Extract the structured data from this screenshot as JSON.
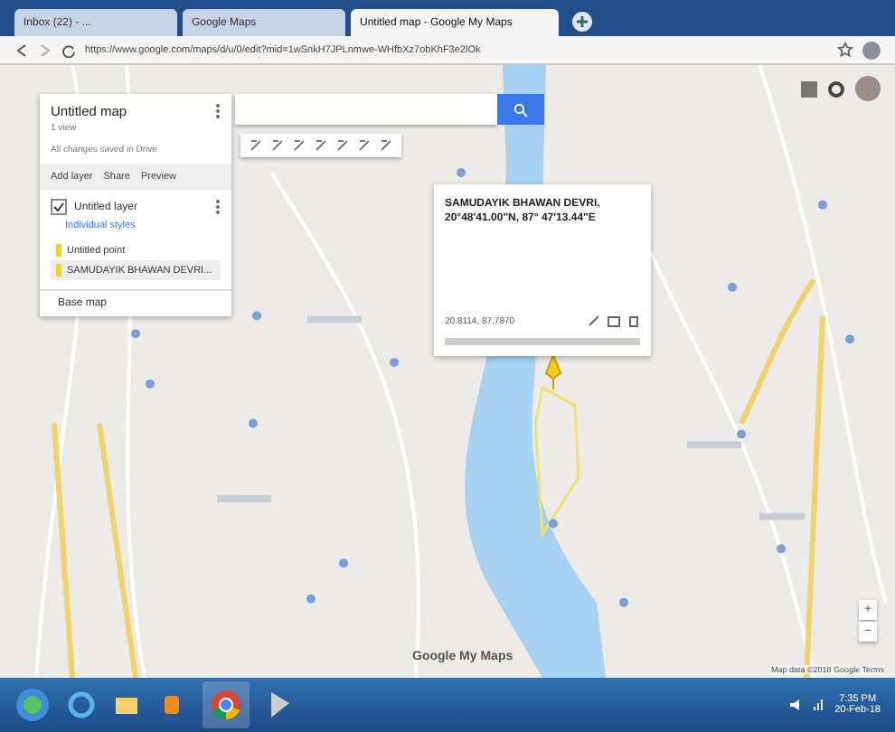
{
  "browser": {
    "tabs": [
      {
        "title": "Inbox (22) - ...",
        "selected": false
      },
      {
        "title": "Google Maps",
        "selected": false
      },
      {
        "title": "Untitled map - Google My Maps",
        "selected": true
      }
    ],
    "url": "https://www.google.com/maps/d/u/0/edit?mid=1wSnkH7JPLnmwe-WHfbXz7obKhF3e2lOk"
  },
  "panel": {
    "title": "Untitled map",
    "subtitle": "1 view",
    "status": "All changes saved in Drive",
    "actions": [
      "Add layer",
      "Share",
      "Preview"
    ],
    "layer": {
      "name": "Untitled layer",
      "checked": true,
      "style": "Individual styles",
      "items": [
        {
          "label": "Untitled point",
          "selected": false
        },
        {
          "label": "SAMUDAYIK BHAWAN DEVRI...",
          "selected": true
        }
      ]
    },
    "base_map": "Base map"
  },
  "popup": {
    "title": "SAMUDAYIK BHAWAN DEVRI, 20°48'41.00\"N, 87° 47'13.44\"E",
    "coords": "20.8114, 87.7870"
  },
  "zoom": [
    "+",
    "−"
  ],
  "branding": "Google My Maps",
  "attribution": "Map data ©2018 Google  Terms",
  "clock": {
    "time": "7:35 PM",
    "date": "20-Feb-18"
  }
}
